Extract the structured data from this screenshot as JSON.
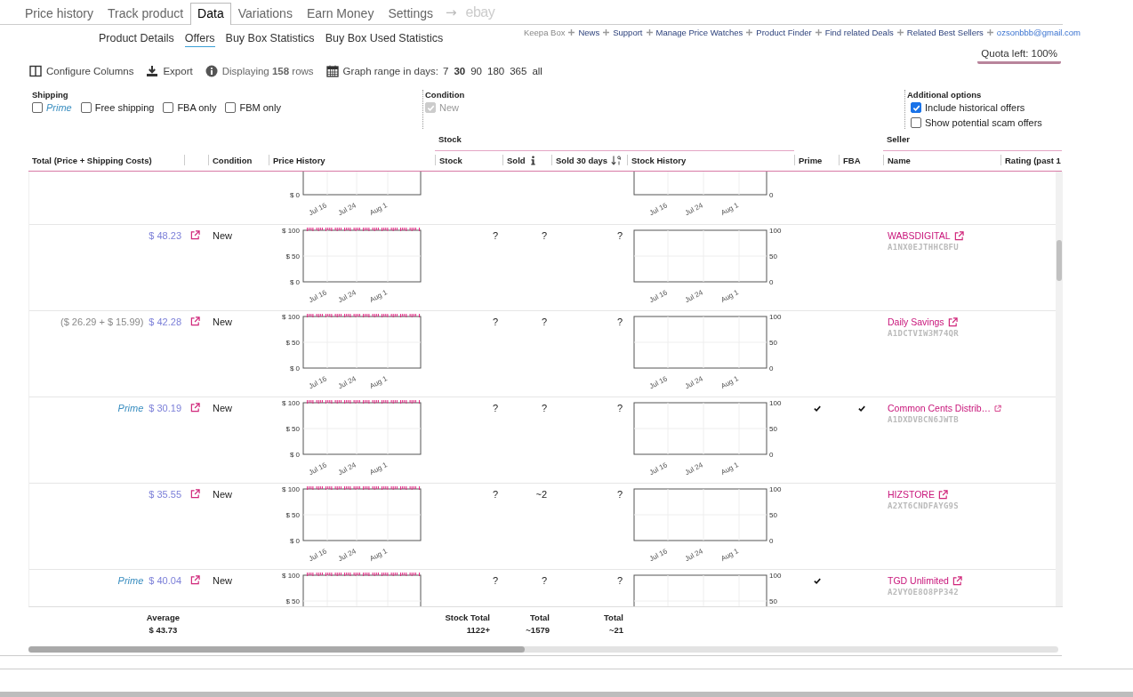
{
  "tabs": [
    {
      "label": "Price history",
      "kind": "tab",
      "selected": false
    },
    {
      "label": "Track product",
      "kind": "tab",
      "selected": false
    },
    {
      "label": "Data",
      "kind": "tab",
      "selected": true
    },
    {
      "label": "Variations",
      "kind": "tab",
      "selected": false
    },
    {
      "label": "Earn Money",
      "kind": "tab",
      "selected": false
    },
    {
      "label": "Settings",
      "kind": "tab",
      "selected": false
    },
    {
      "label": "→",
      "kind": "arrow"
    },
    {
      "label": "ebay",
      "kind": "logo"
    }
  ],
  "subtabs": [
    {
      "label": "Product Details",
      "selected": false
    },
    {
      "label": "Offers",
      "selected": true
    },
    {
      "label": "Buy Box Statistics",
      "selected": false
    },
    {
      "label": "Buy Box Used Statistics",
      "selected": false
    }
  ],
  "top_links": [
    {
      "label": "Keepa Box",
      "kind": "muted"
    },
    {
      "label": "News",
      "kind": "link"
    },
    {
      "label": "Support",
      "kind": "link"
    },
    {
      "label": "Manage Price Watches",
      "kind": "link"
    },
    {
      "label": "Product Finder",
      "kind": "link"
    },
    {
      "label": "Find related Deals",
      "kind": "link"
    },
    {
      "label": "Related Best Sellers",
      "kind": "link"
    },
    {
      "label": "ozsonbbb@gmail.com",
      "kind": "email"
    }
  ],
  "quota": "Quota left: 100%",
  "toolbar": {
    "configure": "Configure Columns",
    "export": "Export",
    "displaying": "Displaying **158** rows",
    "range_label": "Graph range in days:",
    "ranges": [
      {
        "label": "7",
        "selected": false
      },
      {
        "label": "30",
        "selected": true
      },
      {
        "label": "90",
        "selected": false
      },
      {
        "label": "180",
        "selected": false
      },
      {
        "label": "365",
        "selected": false
      },
      {
        "label": "all",
        "selected": false
      }
    ]
  },
  "filters": [
    {
      "title": "Shipping",
      "options": [
        {
          "label": "Prime",
          "kind": "prime",
          "checked": false,
          "disabled": false
        },
        {
          "label": "Free shipping",
          "kind": "plain",
          "checked": false,
          "disabled": false
        },
        {
          "label": "FBA only",
          "kind": "plain",
          "checked": false,
          "disabled": false
        },
        {
          "label": "FBM only",
          "kind": "plain",
          "checked": false,
          "disabled": false
        }
      ]
    },
    {
      "title": "Condition",
      "options": [
        {
          "label": "New",
          "kind": "plain",
          "checked": true,
          "disabled": true
        }
      ]
    },
    {
      "title": "Additional options",
      "options": [
        {
          "label": "Include historical offers",
          "kind": "plain",
          "checked": true,
          "disabled": false
        },
        {
          "label": "Show potential scam offers",
          "kind": "plain",
          "checked": false,
          "disabled": false
        }
      ]
    }
  ],
  "table": {
    "groups": [
      "Stock",
      "Seller"
    ],
    "columns": [
      "Total (Price + Shipping Costs)",
      "Condition",
      "Price History",
      "Stock",
      "Sold",
      "Sold 30 days",
      "Stock History",
      "Prime",
      "FBA",
      "Name",
      "Rating (past 1"
    ],
    "rows": [
      {
        "price_chart": {
          "y_ticks": [
            "$ 0"
          ],
          "x_ticks": [
            "Jul 16",
            "Jul 24",
            "Aug 1"
          ]
        },
        "stock_chart": {
          "y_ticks": [
            "0"
          ],
          "x_ticks": [
            "Jul 16",
            "Jul 24",
            "Aug 1"
          ]
        }
      },
      {
        "price": "$ 48.23",
        "condition": "New",
        "stock": "?",
        "sold": "?",
        "sold_30": "?",
        "prime": false,
        "fba": false,
        "seller": "WABSDIGITAL",
        "seller_id": "A1NX0EJTHHCBFU",
        "price_chart": {
          "y_ticks": [
            "$ 100",
            "$ 50",
            "$ 0"
          ],
          "x_ticks": [
            "Jul 16",
            "Jul 24",
            "Aug 1"
          ]
        },
        "stock_chart": {
          "y_ticks": [
            "100",
            "50",
            "0"
          ],
          "x_ticks": [
            "Jul 16",
            "Jul 24",
            "Aug 1"
          ]
        }
      },
      {
        "breakdown": "($ 26.29 + $ 15.99)",
        "price": "$ 42.28",
        "condition": "New",
        "stock": "?",
        "sold": "?",
        "sold_30": "?",
        "prime": false,
        "fba": false,
        "seller": "Daily Savings",
        "seller_id": "A1DCTVIW3M74QR",
        "price_chart": {
          "y_ticks": [
            "$ 100",
            "$ 50",
            "$ 0"
          ],
          "x_ticks": [
            "Jul 16",
            "Jul 24",
            "Aug 1"
          ]
        },
        "stock_chart": {
          "y_ticks": [
            "100",
            "50",
            "0"
          ],
          "x_ticks": [
            "Jul 16",
            "Jul 24",
            "Aug 1"
          ]
        }
      },
      {
        "shipping_tag": "Prime",
        "price": "$ 30.19",
        "condition": "New",
        "stock": "?",
        "sold": "?",
        "sold_30": "?",
        "prime": true,
        "fba": true,
        "seller": "Common Cents Distrib…",
        "seller_id": "A1DXDVBCN6JWTB",
        "price_chart": {
          "y_ticks": [
            "$ 100",
            "$ 50",
            "$ 0"
          ],
          "x_ticks": [
            "Jul 16",
            "Jul 24",
            "Aug 1"
          ]
        },
        "stock_chart": {
          "y_ticks": [
            "100",
            "50",
            "0"
          ],
          "x_ticks": [
            "Jul 16",
            "Jul 24",
            "Aug 1"
          ]
        }
      },
      {
        "price": "$ 35.55",
        "condition": "New",
        "stock": "?",
        "sold": "~2",
        "sold_30": "?",
        "prime": false,
        "fba": false,
        "seller": "HIZSTORE",
        "seller_id": "A2XT6CNDFAYG9S",
        "price_chart": {
          "y_ticks": [
            "$ 100",
            "$ 50",
            "$ 0"
          ],
          "x_ticks": [
            "Jul 16",
            "Jul 24",
            "Aug 1"
          ]
        },
        "stock_chart": {
          "y_ticks": [
            "100",
            "50",
            "0"
          ],
          "x_ticks": [
            "Jul 16",
            "Jul 24",
            "Aug 1"
          ]
        }
      },
      {
        "shipping_tag": "Prime",
        "price": "$ 40.04",
        "condition": "New",
        "stock": "?",
        "sold": "?",
        "sold_30": "?",
        "prime": true,
        "fba": false,
        "seller": "TGD Unlimited",
        "seller_id": "A2VYOE8O8PP342",
        "price_chart": {
          "y_ticks": [
            "$ 100",
            "$ 50"
          ]
        },
        "stock_chart": {
          "y_ticks": [
            "100",
            "50"
          ]
        }
      }
    ],
    "footer": {
      "average_label": "Average",
      "average": "$ 43.73",
      "stock_label": "Stock Total",
      "stock": "1122+",
      "sold_label": "Total",
      "sold": "~1579",
      "sold_30_label": "Total",
      "sold_30": "~21"
    }
  }
}
